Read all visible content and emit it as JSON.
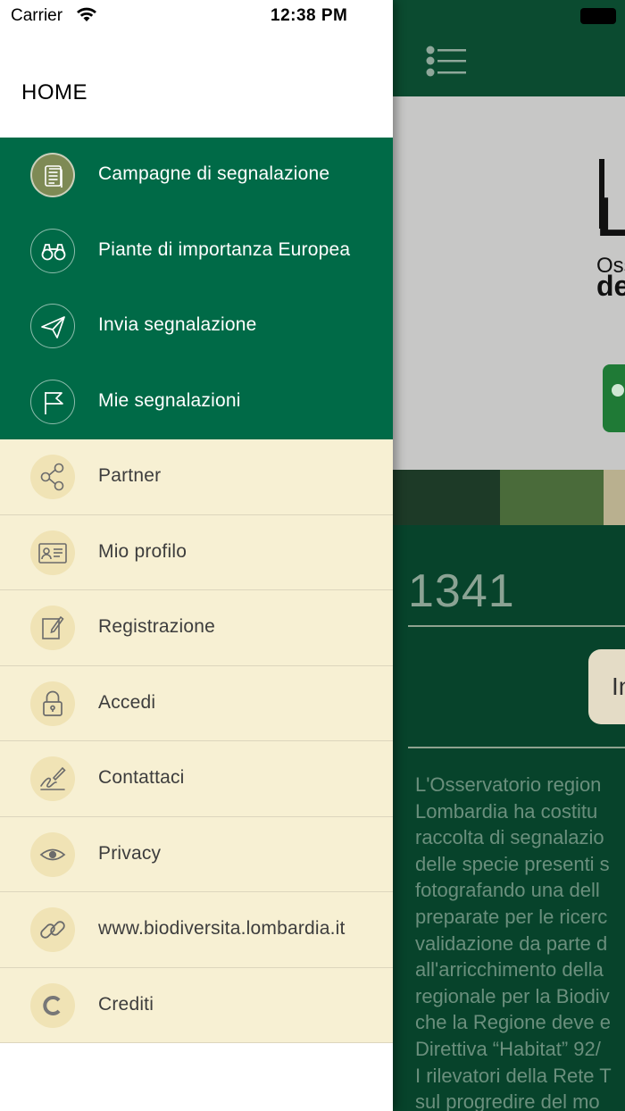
{
  "status_bar": {
    "carrier": "Carrier",
    "time": "12:38 PM"
  },
  "drawer": {
    "title": "HOME",
    "primary_items": [
      {
        "label": "Campagne di segnalazione",
        "icon": "document-icon"
      },
      {
        "label": "Piante di importanza Europea",
        "icon": "binoculars-icon"
      },
      {
        "label": "Invia segnalazione",
        "icon": "paper-plane-icon"
      },
      {
        "label": "Mie segnalazioni",
        "icon": "flag-icon"
      }
    ],
    "secondary_items": [
      {
        "label": "Partner",
        "icon": "share-icon"
      },
      {
        "label": "Mio profilo",
        "icon": "id-card-icon"
      },
      {
        "label": "Registrazione",
        "icon": "edit-icon"
      },
      {
        "label": "Accedi",
        "icon": "lock-icon"
      },
      {
        "label": "Contattaci",
        "icon": "signature-icon"
      },
      {
        "label": "Privacy",
        "icon": "eye-icon"
      },
      {
        "label": "www.biodiversita.lombardia.it",
        "icon": "link-icon"
      },
      {
        "label": "Crediti",
        "icon": "credits-icon"
      }
    ]
  },
  "background_screen": {
    "logo_big": "Lo",
    "logo_line1": "Oss",
    "logo_line2": "de",
    "counter": "1341",
    "button_partial": "In",
    "description": "L'Osservatorio region\nLombardia ha costitu\nraccolta di segnalazio\ndelle specie presenti s\nfotografando una dell\npreparate per le ricerc\nvalidazione da parte d\nall'arricchimento della\nregionale per la Biodiv\nche la Regione deve e\nDirettiva “Habitat” 92/\nI rilevatori della Rete T\nsul progredire del mo"
  },
  "colors": {
    "drawer_green": "#006a47",
    "drawer_beige": "#f7f0d3",
    "active_icon": "#7e8a55",
    "main_dark_green": "#07432b"
  }
}
